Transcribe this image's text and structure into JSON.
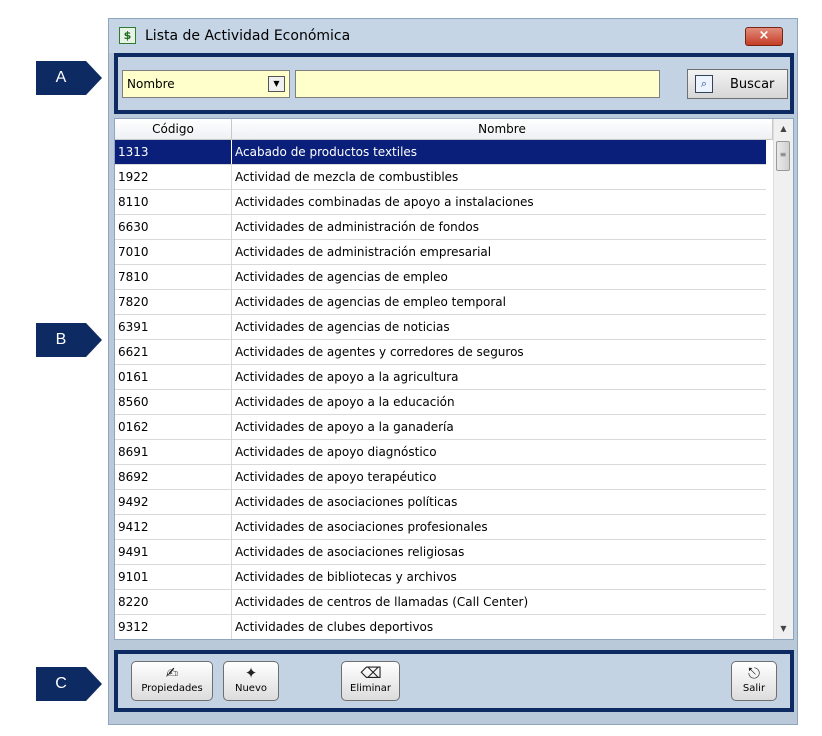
{
  "window": {
    "title": "Lista de Actividad Económica",
    "close_glyph": "×",
    "app_icon": "list-document-icon"
  },
  "search": {
    "field_selected": "Nombre",
    "field_value": "",
    "button_label": "Buscar"
  },
  "table": {
    "columns": [
      "Código",
      "Nombre"
    ],
    "selected_index": 0,
    "rows": [
      {
        "code": "1313",
        "name": "Acabado de productos textiles"
      },
      {
        "code": "1922",
        "name": "Actividad de mezcla de combustibles"
      },
      {
        "code": "8110",
        "name": "Actividades combinadas de apoyo a instalaciones"
      },
      {
        "code": "6630",
        "name": "Actividades de administración de fondos"
      },
      {
        "code": "7010",
        "name": "Actividades de administración empresarial"
      },
      {
        "code": "7810",
        "name": "Actividades de agencias de empleo"
      },
      {
        "code": "7820",
        "name": "Actividades de agencias de empleo temporal"
      },
      {
        "code": "6391",
        "name": "Actividades de agencias de noticias"
      },
      {
        "code": "6621",
        "name": "Actividades de agentes y corredores de seguros"
      },
      {
        "code": "0161",
        "name": "Actividades de apoyo a la agricultura"
      },
      {
        "code": "8560",
        "name": "Actividades de apoyo a la educación"
      },
      {
        "code": "0162",
        "name": "Actividades de apoyo a la ganadería"
      },
      {
        "code": "8691",
        "name": "Actividades de apoyo diagnóstico"
      },
      {
        "code": "8692",
        "name": "Actividades de apoyo terapéutico"
      },
      {
        "code": "9492",
        "name": "Actividades de asociaciones políticas"
      },
      {
        "code": "9412",
        "name": "Actividades de asociaciones profesionales"
      },
      {
        "code": "9491",
        "name": "Actividades de asociaciones religiosas"
      },
      {
        "code": "9101",
        "name": "Actividades de bibliotecas y archivos"
      },
      {
        "code": "8220",
        "name": "Actividades de centros de llamadas (Call Center)"
      },
      {
        "code": "9312",
        "name": "Actividades de clubes deportivos"
      }
    ]
  },
  "toolbar": {
    "properties_label": "Propiedades",
    "new_label": "Nuevo",
    "delete_label": "Eliminar",
    "exit_label": "Salir"
  },
  "callouts": {
    "a": "A",
    "b": "B",
    "c": "C"
  },
  "colors": {
    "panel": "#0d2a63",
    "selection": "#0a1f7a",
    "input_bg": "#ffffcc",
    "window_bg": "#b9c9da"
  }
}
